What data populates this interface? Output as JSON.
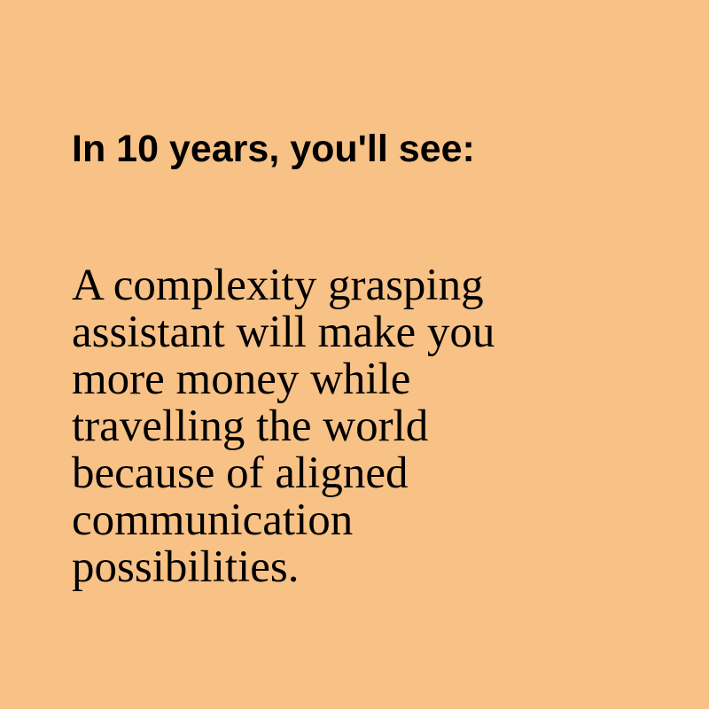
{
  "heading": "In 10 years, you'll see:",
  "body_lines": [
    "A complexity grasping",
    "assistant will make you",
    "more money while",
    "travelling the world",
    "because of aligned",
    "communication",
    "possibilities."
  ],
  "colors": {
    "background": "#f8c185",
    "text": "#000000"
  }
}
